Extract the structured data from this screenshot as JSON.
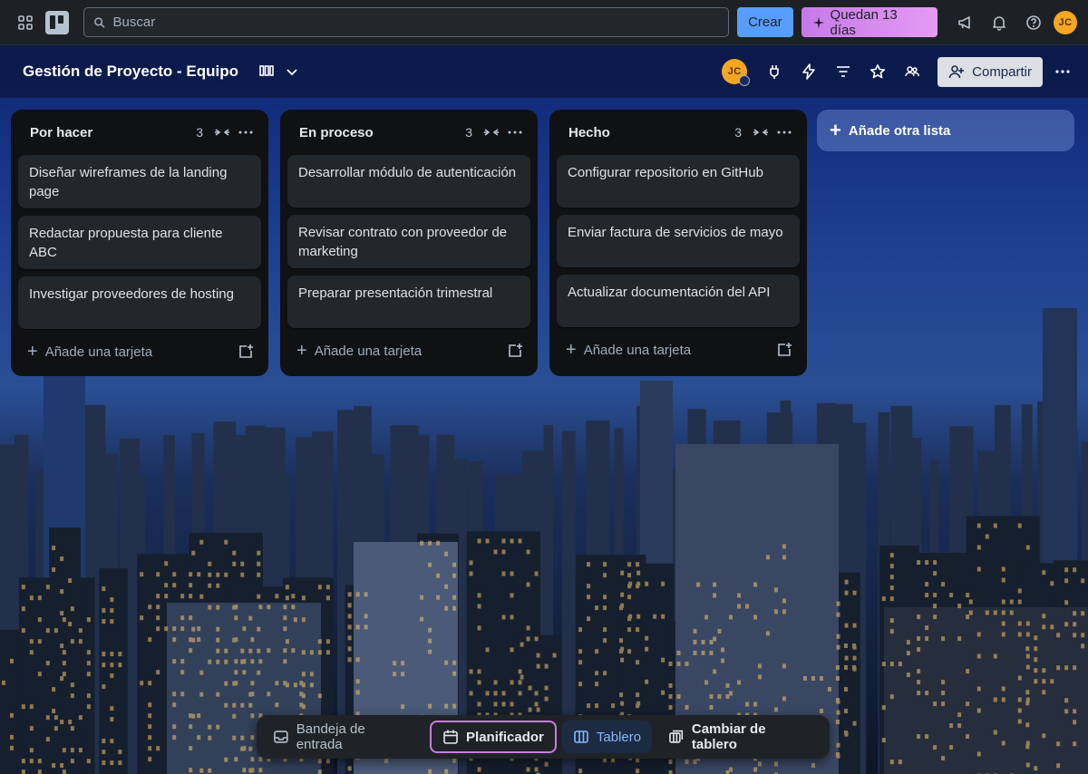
{
  "colors": {
    "topbar_bg": "#1d2125",
    "create_button": "#579dff",
    "trial_button": "#d78af0",
    "list_bg": "#0f1113",
    "card_bg": "#22272b",
    "avatar_bg": "#f5a623",
    "active_tab": "#85b8ff"
  },
  "topbar": {
    "search_placeholder": "Buscar",
    "create_label": "Crear",
    "trial_label": "Quedan 13 días",
    "avatar_initials": "JC"
  },
  "board": {
    "title": "Gestión de Proyecto - Equipo",
    "member_initials": "JC",
    "share_label": "Compartir"
  },
  "lists": [
    {
      "title": "Por hacer",
      "count": "3",
      "cards": [
        "Diseñar wireframes de la landing page",
        "Redactar propuesta para cliente ABC",
        "Investigar proveedores de hosting"
      ],
      "add_card_label": "Añade una tarjeta"
    },
    {
      "title": "En proceso",
      "count": "3",
      "cards": [
        "Desarrollar módulo de autenticación",
        "Revisar contrato con proveedor de marketing",
        "Preparar presentación trimestral"
      ],
      "add_card_label": "Añade una tarjeta"
    },
    {
      "title": "Hecho",
      "count": "3",
      "cards": [
        "Configurar repositorio en GitHub",
        "Enviar factura de servicios de mayo",
        "Actualizar documentación del API"
      ],
      "add_card_label": "Añade una tarjeta"
    }
  ],
  "add_list_label": "Añade otra lista",
  "bottom_nav": {
    "inbox": "Bandeja de entrada",
    "planner": "Planificador",
    "board": "Tablero",
    "switch_board": "Cambiar de tablero"
  }
}
